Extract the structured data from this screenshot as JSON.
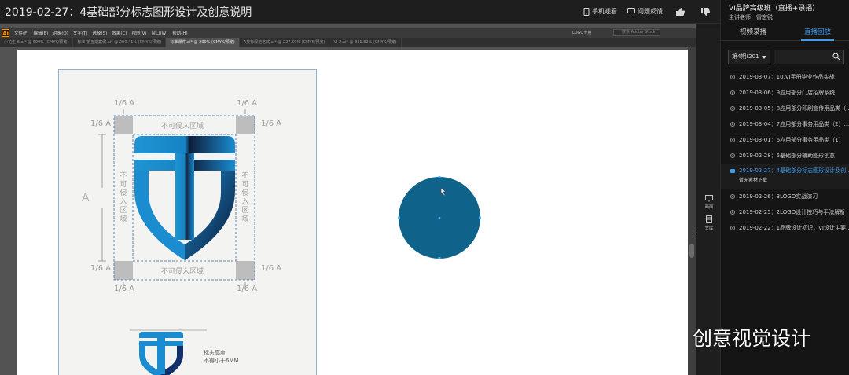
{
  "header": {
    "title": "2019-02-27：4基础部分标志图形设计及创意说明",
    "mobile_label": "手机观看",
    "feedback_label": "问题反馈"
  },
  "panel": {
    "course_title": "VI品牌高级班（直播+录播）",
    "teacher": "主讲老师：雷宏锐",
    "tabs": [
      {
        "label": "视频录播"
      },
      {
        "label": "直播回放"
      }
    ],
    "period_select": "第4期(201",
    "search_placeholder": "",
    "items": [
      {
        "label": "2019-03-07：10.VI手册毕业作品实战"
      },
      {
        "label": "2019-03-06：9应用部分门店招牌系统"
      },
      {
        "label": "2019-03-05：8应用部分印刷宣传用品类（..."
      },
      {
        "label": "2019-03-04：7应用部分事务用品类（2）..."
      },
      {
        "label": "2019-03-01：6应用部分事务用品类（1）"
      },
      {
        "label": "2019-02-28：5基础部分辅助图形创意"
      },
      {
        "label": "2019-02-27：4基础部分标志图形设计及创...",
        "sub": "暂无素材下载"
      },
      {
        "label": "2019-02-26：3LOGO实战演习"
      },
      {
        "label": "2019-02-25：2LOGO设计技巧与手法解析"
      },
      {
        "label": "2019-02-22：1品牌设计初识，VI设计主要..."
      }
    ]
  },
  "strip": {
    "btn1": "画面",
    "btn2": "文库"
  },
  "illustrator": {
    "logo": "Ai",
    "menus": [
      "文件(F)",
      "编辑(E)",
      "对象(O)",
      "文字(T)",
      "选择(S)",
      "效果(C)",
      "视图(V)",
      "窗口(W)",
      "帮助(H)"
    ],
    "workspace": "LOGO专用",
    "search_placeholder": "搜索 Adobe Stock",
    "doc_tabs": [
      {
        "label": "小花生-6.ai* @ 600% (CMYK/预览)"
      },
      {
        "label": "标准-第五期案例.ai* @ 200.41% (CMYK/预览)"
      },
      {
        "label": "标准课件.ai* @ 200% (CMYK/预览)",
        "active": true
      },
      {
        "label": "A奥标规范格式.ai* @ 227.69% (CMYK/预览)"
      },
      {
        "label": "VI-2.ai* @ 831.82% (CMYK/预览)"
      }
    ]
  },
  "sheet": {
    "frac": "1/6 A",
    "zone_h": "不可侵入区域",
    "zone_v": "不可侵入区域",
    "measure": "A",
    "note_line1": "标志高度",
    "note_line2": "不得小于6MM"
  },
  "watermark": {
    "text": "创意视觉设计"
  },
  "colors": {
    "accent": "#3d9cf0",
    "logo_blue": "#1a8ccf",
    "logo_dark": "#0f1e3c",
    "circle": "#0f6289",
    "guide": "#6b8fb8",
    "corner_box": "#bdbdbd"
  }
}
